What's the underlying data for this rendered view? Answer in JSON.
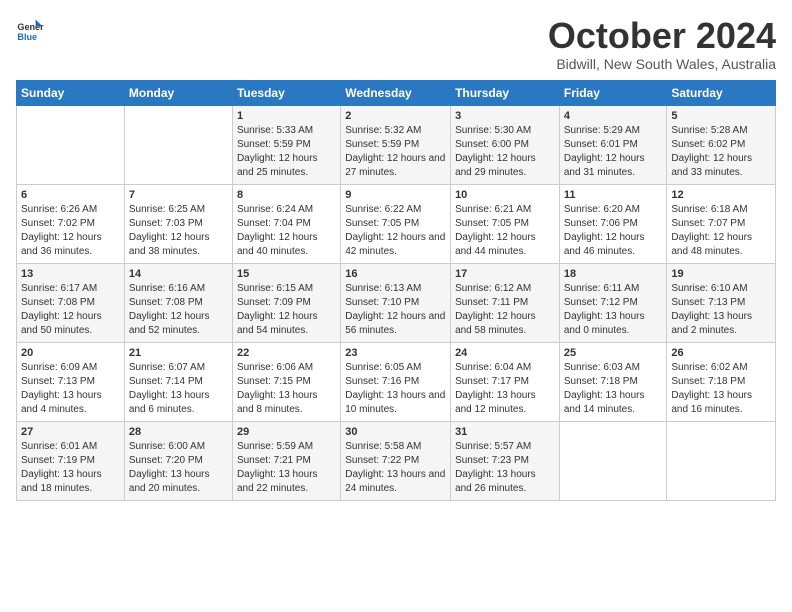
{
  "header": {
    "logo_line1": "General",
    "logo_line2": "Blue",
    "month": "October 2024",
    "location": "Bidwill, New South Wales, Australia"
  },
  "weekdays": [
    "Sunday",
    "Monday",
    "Tuesday",
    "Wednesday",
    "Thursday",
    "Friday",
    "Saturday"
  ],
  "weeks": [
    [
      {
        "day": "",
        "sunrise": "",
        "sunset": "",
        "daylight": ""
      },
      {
        "day": "",
        "sunrise": "",
        "sunset": "",
        "daylight": ""
      },
      {
        "day": "1",
        "sunrise": "Sunrise: 5:33 AM",
        "sunset": "Sunset: 5:59 PM",
        "daylight": "Daylight: 12 hours and 25 minutes."
      },
      {
        "day": "2",
        "sunrise": "Sunrise: 5:32 AM",
        "sunset": "Sunset: 5:59 PM",
        "daylight": "Daylight: 12 hours and 27 minutes."
      },
      {
        "day": "3",
        "sunrise": "Sunrise: 5:30 AM",
        "sunset": "Sunset: 6:00 PM",
        "daylight": "Daylight: 12 hours and 29 minutes."
      },
      {
        "day": "4",
        "sunrise": "Sunrise: 5:29 AM",
        "sunset": "Sunset: 6:01 PM",
        "daylight": "Daylight: 12 hours and 31 minutes."
      },
      {
        "day": "5",
        "sunrise": "Sunrise: 5:28 AM",
        "sunset": "Sunset: 6:02 PM",
        "daylight": "Daylight: 12 hours and 33 minutes."
      }
    ],
    [
      {
        "day": "6",
        "sunrise": "Sunrise: 6:26 AM",
        "sunset": "Sunset: 7:02 PM",
        "daylight": "Daylight: 12 hours and 36 minutes."
      },
      {
        "day": "7",
        "sunrise": "Sunrise: 6:25 AM",
        "sunset": "Sunset: 7:03 PM",
        "daylight": "Daylight: 12 hours and 38 minutes."
      },
      {
        "day": "8",
        "sunrise": "Sunrise: 6:24 AM",
        "sunset": "Sunset: 7:04 PM",
        "daylight": "Daylight: 12 hours and 40 minutes."
      },
      {
        "day": "9",
        "sunrise": "Sunrise: 6:22 AM",
        "sunset": "Sunset: 7:05 PM",
        "daylight": "Daylight: 12 hours and 42 minutes."
      },
      {
        "day": "10",
        "sunrise": "Sunrise: 6:21 AM",
        "sunset": "Sunset: 7:05 PM",
        "daylight": "Daylight: 12 hours and 44 minutes."
      },
      {
        "day": "11",
        "sunrise": "Sunrise: 6:20 AM",
        "sunset": "Sunset: 7:06 PM",
        "daylight": "Daylight: 12 hours and 46 minutes."
      },
      {
        "day": "12",
        "sunrise": "Sunrise: 6:18 AM",
        "sunset": "Sunset: 7:07 PM",
        "daylight": "Daylight: 12 hours and 48 minutes."
      }
    ],
    [
      {
        "day": "13",
        "sunrise": "Sunrise: 6:17 AM",
        "sunset": "Sunset: 7:08 PM",
        "daylight": "Daylight: 12 hours and 50 minutes."
      },
      {
        "day": "14",
        "sunrise": "Sunrise: 6:16 AM",
        "sunset": "Sunset: 7:08 PM",
        "daylight": "Daylight: 12 hours and 52 minutes."
      },
      {
        "day": "15",
        "sunrise": "Sunrise: 6:15 AM",
        "sunset": "Sunset: 7:09 PM",
        "daylight": "Daylight: 12 hours and 54 minutes."
      },
      {
        "day": "16",
        "sunrise": "Sunrise: 6:13 AM",
        "sunset": "Sunset: 7:10 PM",
        "daylight": "Daylight: 12 hours and 56 minutes."
      },
      {
        "day": "17",
        "sunrise": "Sunrise: 6:12 AM",
        "sunset": "Sunset: 7:11 PM",
        "daylight": "Daylight: 12 hours and 58 minutes."
      },
      {
        "day": "18",
        "sunrise": "Sunrise: 6:11 AM",
        "sunset": "Sunset: 7:12 PM",
        "daylight": "Daylight: 13 hours and 0 minutes."
      },
      {
        "day": "19",
        "sunrise": "Sunrise: 6:10 AM",
        "sunset": "Sunset: 7:13 PM",
        "daylight": "Daylight: 13 hours and 2 minutes."
      }
    ],
    [
      {
        "day": "20",
        "sunrise": "Sunrise: 6:09 AM",
        "sunset": "Sunset: 7:13 PM",
        "daylight": "Daylight: 13 hours and 4 minutes."
      },
      {
        "day": "21",
        "sunrise": "Sunrise: 6:07 AM",
        "sunset": "Sunset: 7:14 PM",
        "daylight": "Daylight: 13 hours and 6 minutes."
      },
      {
        "day": "22",
        "sunrise": "Sunrise: 6:06 AM",
        "sunset": "Sunset: 7:15 PM",
        "daylight": "Daylight: 13 hours and 8 minutes."
      },
      {
        "day": "23",
        "sunrise": "Sunrise: 6:05 AM",
        "sunset": "Sunset: 7:16 PM",
        "daylight": "Daylight: 13 hours and 10 minutes."
      },
      {
        "day": "24",
        "sunrise": "Sunrise: 6:04 AM",
        "sunset": "Sunset: 7:17 PM",
        "daylight": "Daylight: 13 hours and 12 minutes."
      },
      {
        "day": "25",
        "sunrise": "Sunrise: 6:03 AM",
        "sunset": "Sunset: 7:18 PM",
        "daylight": "Daylight: 13 hours and 14 minutes."
      },
      {
        "day": "26",
        "sunrise": "Sunrise: 6:02 AM",
        "sunset": "Sunset: 7:18 PM",
        "daylight": "Daylight: 13 hours and 16 minutes."
      }
    ],
    [
      {
        "day": "27",
        "sunrise": "Sunrise: 6:01 AM",
        "sunset": "Sunset: 7:19 PM",
        "daylight": "Daylight: 13 hours and 18 minutes."
      },
      {
        "day": "28",
        "sunrise": "Sunrise: 6:00 AM",
        "sunset": "Sunset: 7:20 PM",
        "daylight": "Daylight: 13 hours and 20 minutes."
      },
      {
        "day": "29",
        "sunrise": "Sunrise: 5:59 AM",
        "sunset": "Sunset: 7:21 PM",
        "daylight": "Daylight: 13 hours and 22 minutes."
      },
      {
        "day": "30",
        "sunrise": "Sunrise: 5:58 AM",
        "sunset": "Sunset: 7:22 PM",
        "daylight": "Daylight: 13 hours and 24 minutes."
      },
      {
        "day": "31",
        "sunrise": "Sunrise: 5:57 AM",
        "sunset": "Sunset: 7:23 PM",
        "daylight": "Daylight: 13 hours and 26 minutes."
      },
      {
        "day": "",
        "sunrise": "",
        "sunset": "",
        "daylight": ""
      },
      {
        "day": "",
        "sunrise": "",
        "sunset": "",
        "daylight": ""
      }
    ]
  ]
}
